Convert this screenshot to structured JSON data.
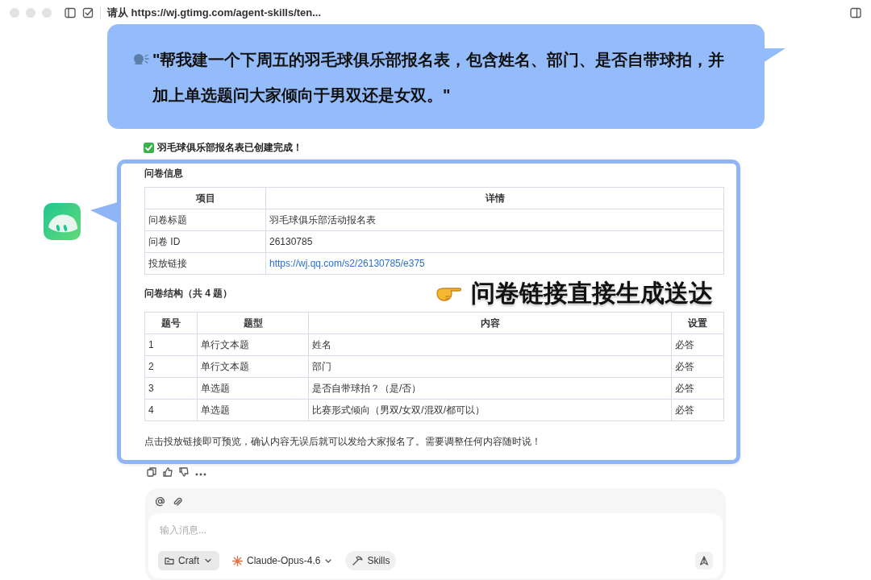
{
  "window": {
    "title": "请从 https://wj.gtimg.com/agent-skills/ten..."
  },
  "callout": {
    "text": "\"帮我建一个下周五的羽毛球俱乐部报名表，包含姓名、部门、是否自带球拍，并加上单选题问大家倾向于男双还是女双。\""
  },
  "status_message": "羽毛球俱乐部报名表已创建完成！",
  "survey_info": {
    "heading": "问卷信息",
    "columns": [
      "项目",
      "详情"
    ],
    "rows": [
      {
        "label": "问卷标题",
        "value": "羽毛球俱乐部活动报名表",
        "kind": "text"
      },
      {
        "label": "问卷 ID",
        "value": "26130785",
        "kind": "text"
      },
      {
        "label": "投放链接",
        "value": "https://wj.qq.com/s2/26130785/e375",
        "kind": "link"
      }
    ]
  },
  "structure": {
    "heading": "问卷结构（共 4 题）",
    "columns": [
      "题号",
      "题型",
      "内容",
      "设置"
    ],
    "rows": [
      [
        "1",
        "单行文本题",
        "姓名",
        "必答"
      ],
      [
        "2",
        "单行文本题",
        "部门",
        "必答"
      ],
      [
        "3",
        "单选题",
        "是否自带球拍？（是/否）",
        "必答"
      ],
      [
        "4",
        "单选题",
        "比赛形式倾向（男双/女双/混双/都可以）",
        "必答"
      ]
    ]
  },
  "annotation": "问卷链接直接生成送达",
  "footer_note": "点击投放链接即可预览，确认内容无误后就可以发给大家报名了。需要调整任何内容随时说！",
  "composer": {
    "placeholder": "输入消息...",
    "mode": "Craft",
    "model": "Claude-Opus-4.6",
    "skills": "Skills"
  }
}
